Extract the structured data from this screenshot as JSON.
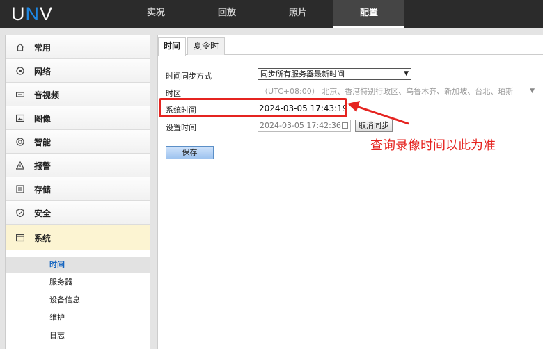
{
  "brand": {
    "logo_text_u": "U",
    "logo_text_n": "N",
    "logo_text_v": "V"
  },
  "topnav": {
    "tabs": [
      "实况",
      "回放",
      "照片",
      "配置"
    ],
    "active_index": 3
  },
  "sidebar": {
    "menu": [
      {
        "label": "常用",
        "icon": "home-icon"
      },
      {
        "label": "网络",
        "icon": "globe-icon"
      },
      {
        "label": "音视频",
        "icon": "video-icon"
      },
      {
        "label": "图像",
        "icon": "image-icon"
      },
      {
        "label": "智能",
        "icon": "smart-icon"
      },
      {
        "label": "报警",
        "icon": "warning-icon"
      },
      {
        "label": "存储",
        "icon": "storage-icon"
      },
      {
        "label": "安全",
        "icon": "shield-icon"
      },
      {
        "label": "系统",
        "icon": "window-icon"
      }
    ],
    "submenu": [
      "时间",
      "服务器",
      "设备信息",
      "维护",
      "日志"
    ],
    "active_submenu": 0
  },
  "content": {
    "tabs": [
      "时间",
      "夏令时"
    ],
    "active_tab": 0,
    "fields": {
      "sync_label": "时间同步方式",
      "sync_value": "同步所有服务器最新时间",
      "tz_label": "时区",
      "tz_value": "（UTC+08:00） 北京、香港特别行政区、乌鲁木齐、新加坡、台北、珀斯",
      "systime_label": "系统时间",
      "systime_value": "2024-03-05 17:43:19",
      "settime_label": "设置时间",
      "settime_value": "2024-03-05 17:42:36",
      "cancel_sync_label": "取消同步",
      "save_label": "保存"
    }
  },
  "annotation": {
    "text": "查询录像时间以此为准",
    "color": "#e52420"
  }
}
